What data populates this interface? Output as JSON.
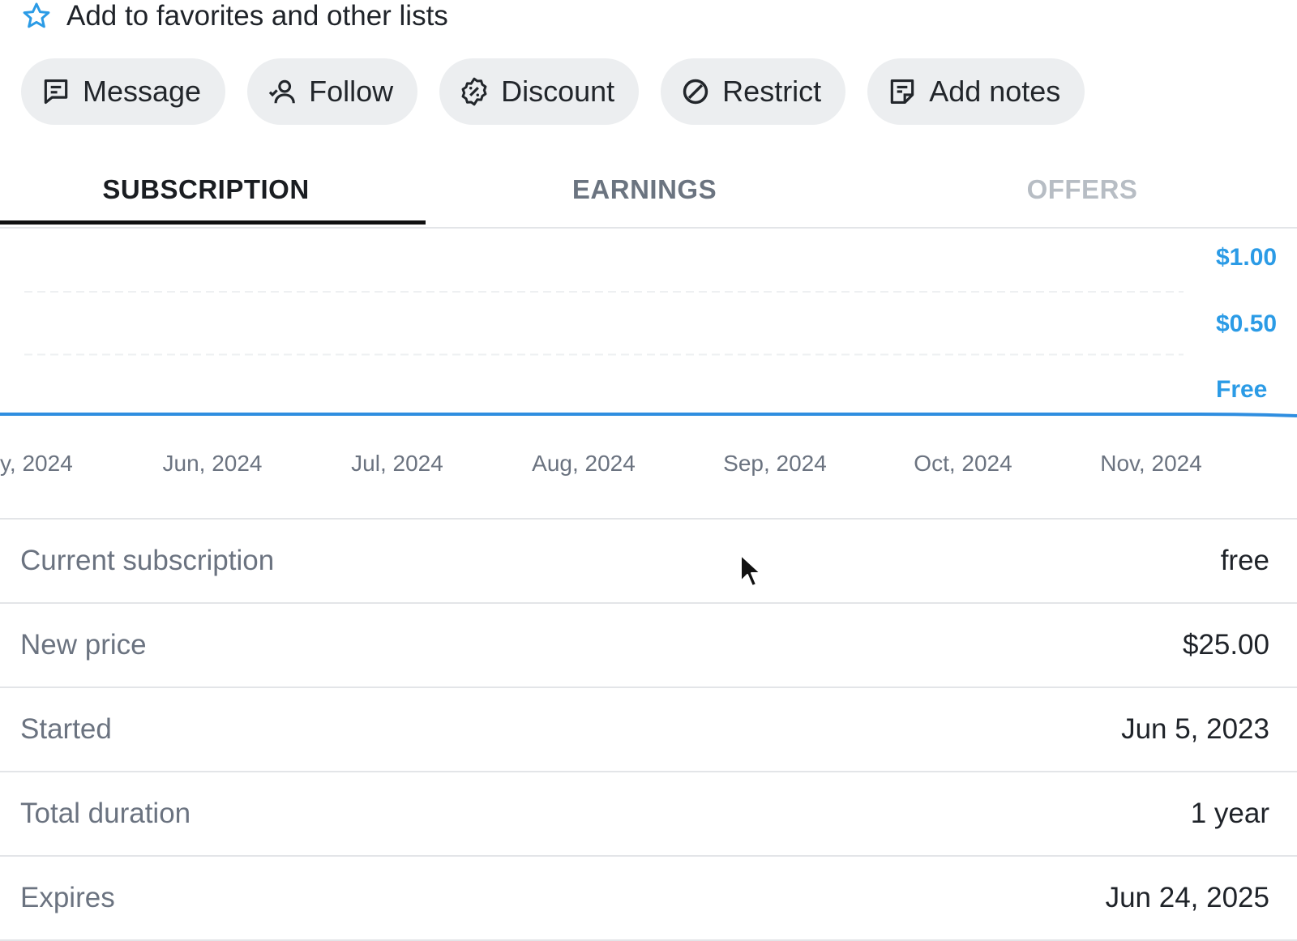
{
  "favorites": {
    "label": "Add to favorites and other lists",
    "icon": "star-outline-icon",
    "icon_color": "#2b9be6"
  },
  "actions": [
    {
      "label": "Message",
      "icon": "message-icon"
    },
    {
      "label": "Follow",
      "icon": "follow-user-icon"
    },
    {
      "label": "Discount",
      "icon": "discount-badge-icon"
    },
    {
      "label": "Restrict",
      "icon": "restrict-icon"
    },
    {
      "label": "Add notes",
      "icon": "notes-icon"
    }
  ],
  "tabs": [
    {
      "label": "SUBSCRIPTION",
      "active": true
    },
    {
      "label": "EARNINGS",
      "active": false
    },
    {
      "label": "OFFERS",
      "active": false
    }
  ],
  "chart_data": {
    "type": "line",
    "y_tick_labels": [
      "$1.00",
      "$0.50",
      "Free"
    ],
    "y_ticks": [
      1.0,
      0.5,
      0
    ],
    "ylim": [
      0,
      1.0
    ],
    "x_tick_labels": [
      "y, 2024",
      "Jun, 2024",
      "Jul, 2024",
      "Aug, 2024",
      "Sep, 2024",
      "Oct, 2024",
      "Nov, 2024"
    ],
    "series": [
      {
        "values": [
          0,
          0,
          0,
          0,
          0,
          0,
          0
        ]
      }
    ],
    "line_color": "#2f8ee0",
    "tick_color": "#2b9be6",
    "grid": true
  },
  "details": [
    {
      "key": "Current subscription",
      "value": "free"
    },
    {
      "key": "New price",
      "value": "$25.00"
    },
    {
      "key": "Started",
      "value": "Jun 5, 2023"
    },
    {
      "key": "Total duration",
      "value": "1 year"
    },
    {
      "key": "Expires",
      "value": "Jun 24, 2025"
    }
  ]
}
